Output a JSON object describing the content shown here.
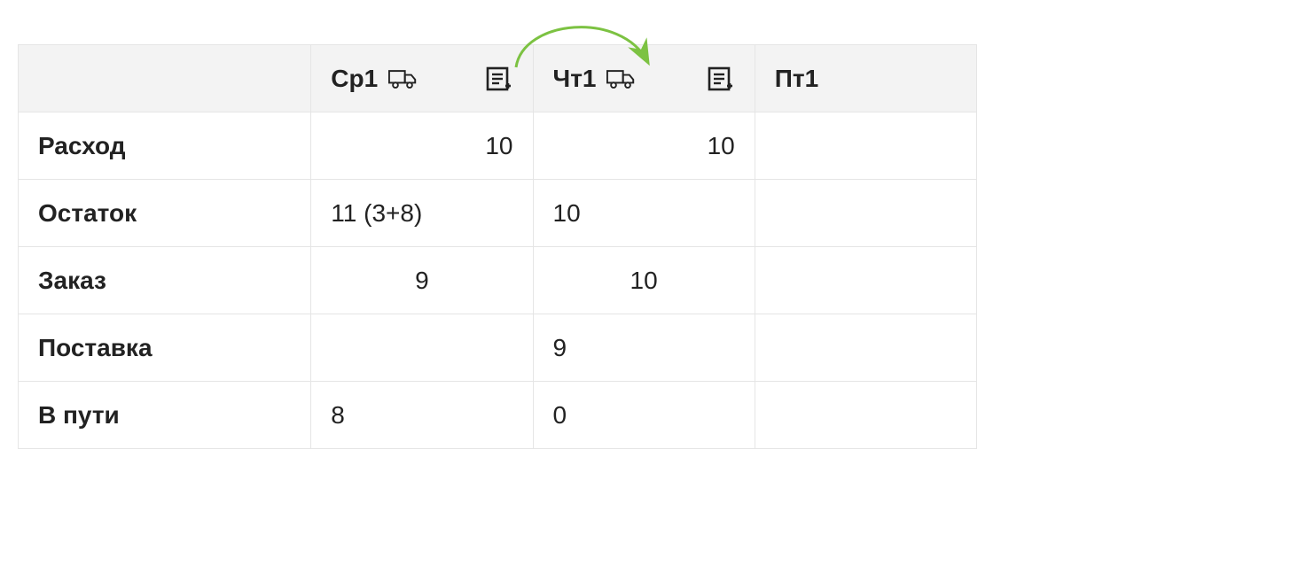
{
  "columns": {
    "col1": "Ср1",
    "col2": "Чт1",
    "col3": "Пт1"
  },
  "rows": {
    "consumption": {
      "label": "Расход",
      "col1": "10",
      "col2": "10",
      "col3": ""
    },
    "balance": {
      "label": "Остаток",
      "col1": "11 (3+8)",
      "col2": "10",
      "col3": ""
    },
    "order": {
      "label": "Заказ",
      "col1": "9",
      "col2": "10",
      "col3": ""
    },
    "delivery": {
      "label": "Поставка",
      "col1": "",
      "col2": "9",
      "col3": ""
    },
    "in_transit": {
      "label": "В пути",
      "col1": "8",
      "col2": "0",
      "col3": ""
    }
  },
  "colors": {
    "arrow": "#7cc242"
  }
}
